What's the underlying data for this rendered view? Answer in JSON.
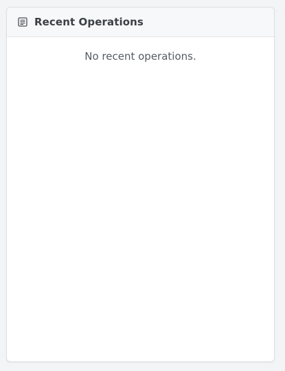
{
  "panel": {
    "title": "Recent Operations",
    "icon": "list-document-icon",
    "empty_message": "No recent operations."
  },
  "colors": {
    "page_background": "#f3f4f6",
    "card_background": "#ffffff",
    "header_background": "#f7f8f9",
    "title_text": "#3a3f45",
    "body_text": "#555b62"
  }
}
